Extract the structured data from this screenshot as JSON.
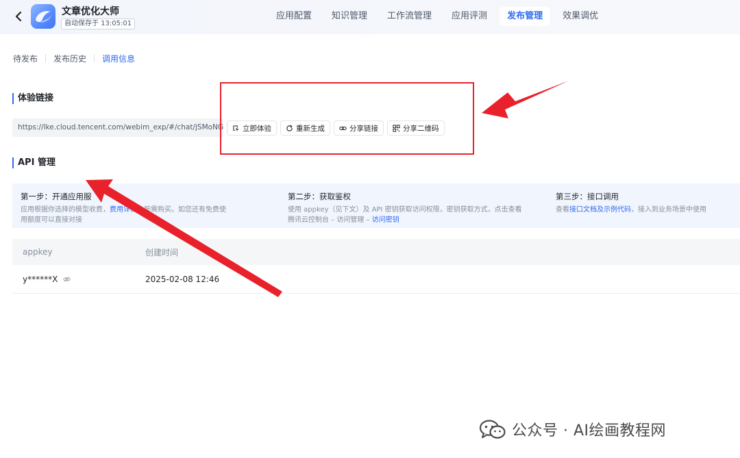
{
  "header": {
    "app_name": "文章优化大师",
    "autosave": "自动保存于 13:05:01",
    "tabs": [
      {
        "label": "应用配置",
        "active": false
      },
      {
        "label": "知识管理",
        "active": false
      },
      {
        "label": "工作流管理",
        "active": false
      },
      {
        "label": "应用评测",
        "active": false
      },
      {
        "label": "发布管理",
        "active": true
      },
      {
        "label": "效果调优",
        "active": false
      }
    ]
  },
  "sub_tabs": [
    {
      "label": "待发布",
      "active": false
    },
    {
      "label": "发布历史",
      "active": false
    },
    {
      "label": "调用信息",
      "active": true
    }
  ],
  "experience": {
    "title": "体验链接",
    "url": "https://lke.cloud.tencent.com/webim_exp/#/chat/jSMoNG",
    "buttons": [
      {
        "label": "立即体验",
        "icon": "pointer-icon"
      },
      {
        "label": "重新生成",
        "icon": "refresh-icon"
      },
      {
        "label": "分享链接",
        "icon": "link-icon"
      },
      {
        "label": "分享二维码",
        "icon": "qrcode-icon"
      }
    ]
  },
  "api": {
    "title": "API 管理",
    "steps": [
      {
        "title": "第一步：开通应用服",
        "desc_line1_a": "应用根据你选择的模型收费，",
        "desc_line1_link": "费用详情",
        "desc_line1_b": "，按需购买。如您还有免费使",
        "desc_line2": "用额度可以直接对接"
      },
      {
        "title": "第二步：获取鉴权",
        "desc_line1": "使用 appkey（见下文）及 API 密钥获取访问权限，密钥获取方式，点击查看",
        "desc_line2_a": "腾讯云控制台 – 访问管理 – ",
        "desc_line2_link": "访问密钥"
      },
      {
        "title": "第三步：接口调用",
        "desc_a": "查看",
        "desc_link": "接口文档及示例代码",
        "desc_b": "，接入到业务场景中使用"
      }
    ],
    "table": {
      "columns": [
        "appkey",
        "创建时间"
      ],
      "rows": [
        {
          "appkey": "y******X",
          "created": "2025-02-08 12:46"
        }
      ]
    }
  },
  "watermark": {
    "text": "公众号 · AI绘画教程网"
  },
  "colors": {
    "accent": "#2e6bf2",
    "annotation": "#e8212a",
    "steps_bg": "#f1f5fd"
  }
}
